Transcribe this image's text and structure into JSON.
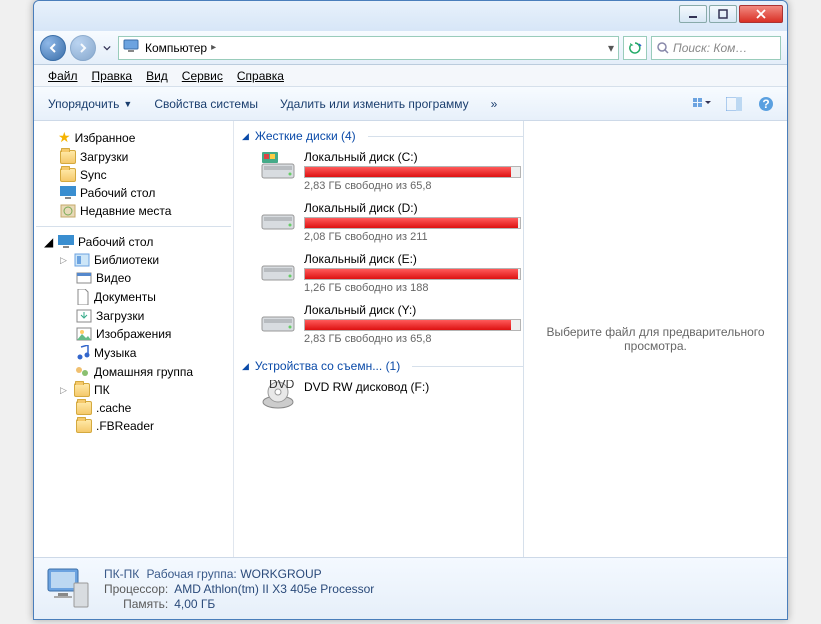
{
  "titlebar": {
    "min": "−",
    "max": "▢",
    "close": "×"
  },
  "address": {
    "location": "Компьютер",
    "sep": "▸"
  },
  "search": {
    "placeholder": "Поиск: Ком…"
  },
  "menu": {
    "file": "Файл",
    "edit": "Правка",
    "view": "Вид",
    "tools": "Сервис",
    "help": "Справка"
  },
  "toolbar": {
    "organize": "Упорядочить",
    "sysprops": "Свойства системы",
    "uninstall": "Удалить или изменить программу",
    "more": "»"
  },
  "nav": {
    "favorites": "Избранное",
    "favitems": [
      {
        "label": "Загрузки"
      },
      {
        "label": "Sync"
      },
      {
        "label": "Рабочий стол"
      },
      {
        "label": "Недавние места"
      }
    ],
    "desktop": "Рабочий стол",
    "libraries": "Библиотеки",
    "libitems": [
      {
        "label": "Видео"
      },
      {
        "label": "Документы"
      },
      {
        "label": "Загрузки"
      },
      {
        "label": "Изображения"
      },
      {
        "label": "Музыка"
      }
    ],
    "homegroup": "Домашняя группа",
    "pc": "ПК",
    "pcitems": [
      {
        "label": ".cache"
      },
      {
        "label": ".FBReader"
      }
    ]
  },
  "groups": {
    "hdd": {
      "title": "Жесткие диски (4)",
      "drives": [
        {
          "name": "Локальный диск (C:)",
          "free": "2,83 ГБ свободно из 65,8",
          "fill": 96
        },
        {
          "name": "Локальный диск (D:)",
          "free": "2,08 ГБ свободно из 211",
          "fill": 99
        },
        {
          "name": "Локальный диск (E:)",
          "free": "1,26 ГБ свободно из 188",
          "fill": 99
        },
        {
          "name": "Локальный диск (Y:)",
          "free": "2,83 ГБ свободно из 65,8",
          "fill": 96
        }
      ]
    },
    "removable": {
      "title": "Устройства со съемн... (1)",
      "drives": [
        {
          "name": "DVD RW дисковод (F:)"
        }
      ]
    }
  },
  "preview": {
    "empty": "Выберите файл для предварительного просмотра."
  },
  "details": {
    "pcname": "ПК-ПК",
    "workgroup_k": "Рабочая группа:",
    "workgroup_v": "WORKGROUP",
    "cpu_k": "Процессор:",
    "cpu_v": "AMD Athlon(tm) II X3 405e Processor",
    "mem_k": "Память:",
    "mem_v": "4,00 ГБ"
  }
}
